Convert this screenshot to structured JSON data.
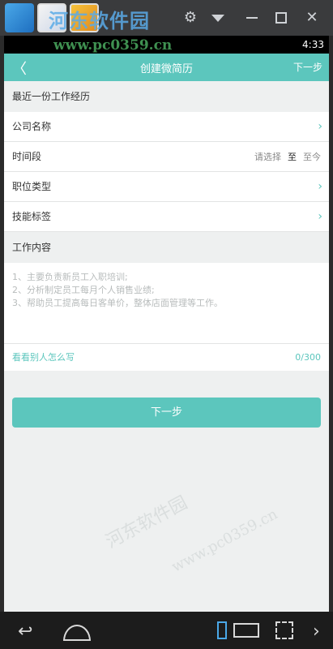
{
  "watermark": {
    "brand": "河东软件园",
    "url": "www.pc0359.cn"
  },
  "statusbar": {
    "time": "4:33"
  },
  "navbar": {
    "back": "〈",
    "title": "创建微简历",
    "next": "下一步"
  },
  "form": {
    "section_recent": "最近一份工作经历",
    "company_label": "公司名称",
    "period_label": "时间段",
    "period_select": "请选择",
    "period_to": "至",
    "period_now": "至今",
    "job_type_label": "职位类型",
    "skill_tags_label": "技能标签",
    "section_work": "工作内容",
    "work_placeholder_1": "1、主要负责新员工入职培训;",
    "work_placeholder_2": "2、分析制定员工每月个人销售业绩;",
    "work_placeholder_3": "3、帮助员工提高每日客单价，整体店面管理等工作。",
    "examples_link": "看看别人怎么写",
    "char_count": "0/300",
    "next_button": "下一步"
  },
  "icons": {
    "chevron": "›"
  }
}
